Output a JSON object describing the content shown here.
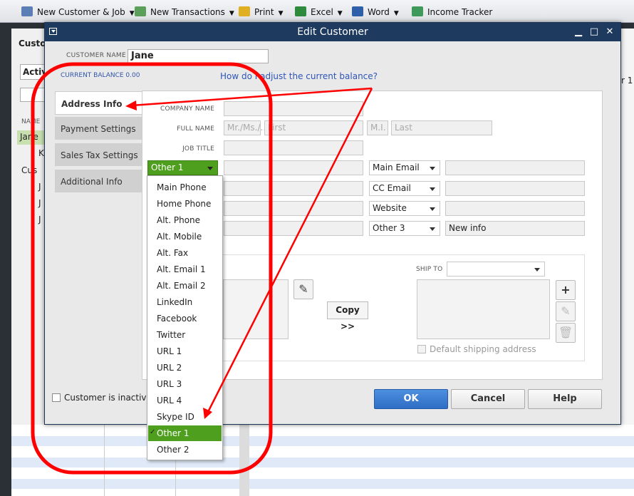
{
  "toolbar": {
    "new_customer_job": "New Customer & Job",
    "new_transactions": "New Transactions",
    "print": "Print",
    "excel": "Excel",
    "word": "Word",
    "income_tracker": "Income Tracker",
    "window_title_partial": "Customer Center: Jane"
  },
  "background_left": {
    "header": "Custo",
    "active_select": "Activ",
    "name_col": "NAME",
    "rows": [
      "Jane",
      "K",
      "Cus",
      "J",
      "J",
      "J"
    ]
  },
  "background_right": {
    "partial_text": "r 1"
  },
  "dialog": {
    "title": "Edit Customer",
    "customer_name_label": "CUSTOMER NAME",
    "customer_name_value": "Jane",
    "current_balance_label": "CURRENT BALANCE  0.00",
    "help_link": "How do I adjust the current balance?",
    "tabs": [
      {
        "label": "Address Info"
      },
      {
        "label": "Payment Settings"
      },
      {
        "label": "Sales Tax Settings"
      },
      {
        "label": "Additional Info"
      }
    ],
    "company_name_label": "COMPANY NAME",
    "full_name_label": "FULL NAME",
    "full_name_placeholders": {
      "title": "Mr./Ms./...",
      "first": "First",
      "mi": "M.I.",
      "last": "Last"
    },
    "job_title_label": "JOB TITLE",
    "phone_select": "Other 1",
    "right_fields": [
      {
        "select": "Main Email",
        "value": ""
      },
      {
        "select": "CC Email",
        "value": ""
      },
      {
        "select": "Website",
        "value": ""
      },
      {
        "select": "Other 3",
        "value": "New info"
      }
    ],
    "ship_to_label": "SHIP TO",
    "copy_button": "Copy >>",
    "default_shipping": "Default shipping address",
    "inactive_label": "Customer is inactive",
    "ok": "OK",
    "cancel": "Cancel",
    "help": "Help"
  },
  "dropdown": {
    "items": [
      "Main Phone",
      "Home Phone",
      "Alt. Phone",
      "Alt. Mobile",
      "Alt. Fax",
      "Alt. Email 1",
      "Alt. Email 2",
      "LinkedIn",
      "Facebook",
      "Twitter",
      "URL 1",
      "URL 2",
      "URL 3",
      "URL 4",
      "Skype ID",
      "Other 1",
      "Other 2"
    ],
    "selected": "Other 1",
    "check_mark": "✓"
  },
  "colors": {
    "titlebar": "#1e3a5f",
    "selected_green": "#4f9f1f",
    "ok_blue": "#2e6dc4",
    "annotation_red": "#ff0000",
    "link_blue": "#2e55b8"
  }
}
